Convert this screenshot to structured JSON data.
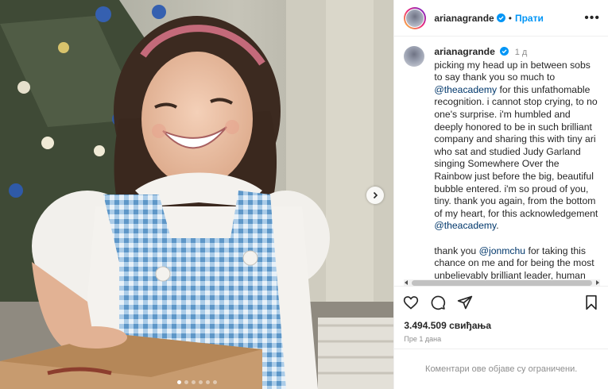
{
  "media": {
    "carousel_dots": 6,
    "active_dot": 0
  },
  "header": {
    "username": "arianagrande",
    "separator": "•",
    "follow_label": "Прати",
    "more_label": "•••"
  },
  "caption": {
    "username": "arianagrande",
    "time": "1 д",
    "segments": [
      {
        "text": "picking my head up in between sobs to say thank you so much to ",
        "mention": false
      },
      {
        "text": "@theacademy",
        "mention": true
      },
      {
        "text": " for this unfathomable recognition. i cannot stop crying, to no one's surprise. i'm humbled and deeply honored to be in such brilliant company and sharing this with tiny ari who sat and studied Judy Garland singing Somewhere Over the Rainbow just before the big, beautiful bubble entered. i'm so proud of you, tiny. thank you again, from the bottom of my heart, for this acknowledgement ",
        "mention": false
      },
      {
        "text": "@theacademy",
        "mention": true
      },
      {
        "text": ".",
        "mention": false
      }
    ],
    "segments2": [
      {
        "text": "thank you ",
        "mention": false
      },
      {
        "text": "@jonmchu",
        "mention": true
      },
      {
        "text": " for taking this chance on me and for being the most unbelievably brilliant leader, human being, and most fierce friend. i am so",
        "mention": false
      }
    ]
  },
  "stats": {
    "likes": "3.494.509 свиђања",
    "date": "Пре 1 дана"
  },
  "comments": {
    "disabled_text": "Коментари ове објаве су ограничени."
  },
  "colors": {
    "accent": "#0095f6",
    "mention": "#00376b",
    "muted": "#8e8e8e",
    "text": "#262626"
  }
}
